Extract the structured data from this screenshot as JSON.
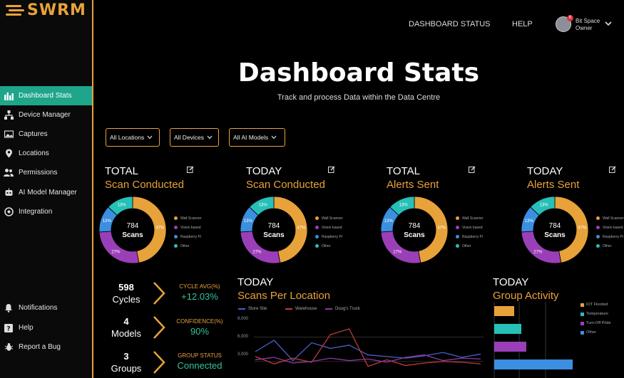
{
  "brand": {
    "logo": "SWRM"
  },
  "sidebar": {
    "items": [
      {
        "label": "Dashboard Stats"
      },
      {
        "label": "Device Manager"
      },
      {
        "label": "Captures"
      },
      {
        "label": "Locations"
      },
      {
        "label": "Permissions"
      },
      {
        "label": "AI Model Manager"
      },
      {
        "label": "Integration"
      }
    ],
    "bottom_items": [
      {
        "label": "Notifications"
      },
      {
        "label": "Help"
      },
      {
        "label": "Report a Bug"
      }
    ]
  },
  "topbar": {
    "dashboard_status": "DASHBOARD STATUS",
    "help": "HELP",
    "user_line1": "Bit Space",
    "user_line2": "Owner",
    "badge": "6"
  },
  "page": {
    "title": "Dashboard Stats",
    "subtitle": "Track and process Data within the Data Centre"
  },
  "filters": {
    "locations": "All Locations",
    "devices": "All Devices",
    "models": "All AI Models"
  },
  "cards": [
    {
      "line1": "TOTAL",
      "line2": "Scan Conducted",
      "center_value": "784",
      "center_label": "Scans"
    },
    {
      "line1": "TODAY",
      "line2": "Scan Conducted",
      "center_value": "784",
      "center_label": "Scans"
    },
    {
      "line1": "TOTAL",
      "line2": "Alerts Sent",
      "center_value": "784",
      "center_label": "Scans"
    },
    {
      "line1": "TODAY",
      "line2": "Alerts Sent",
      "center_value": "784",
      "center_label": "Scans"
    }
  ],
  "donut_segments": [
    {
      "name": "Wall Scanner",
      "pct": 47,
      "label": "47%",
      "color": "#e8a23a"
    },
    {
      "name": "Vision based",
      "pct": 27,
      "label": "27%",
      "color": "#9b3fb8"
    },
    {
      "name": "Raspberry Pi",
      "pct": 13,
      "label": "13%",
      "color": "#3b8fe0"
    },
    {
      "name": "Other",
      "pct": 13,
      "label": "13%",
      "color": "#27c0b8"
    }
  ],
  "metrics": [
    {
      "value": "598",
      "unit": "Cycles",
      "key": "CYCLE AVG(%)",
      "kvalue": "+12.03%"
    },
    {
      "value": "4",
      "unit": "Models",
      "key": "CONFIDENCE(%)",
      "kvalue": "90%"
    },
    {
      "value": "3",
      "unit": "Groups",
      "key": "GROUP STATUS",
      "kvalue": "Connected"
    }
  ],
  "scans_chart": {
    "line1": "TODAY",
    "line2": "Scans Per Location",
    "legend": [
      {
        "name": "Store Site",
        "color": "#4a5fc8"
      },
      {
        "name": "Warehouse",
        "color": "#c23a3a"
      },
      {
        "name": "Doug's Truck",
        "color": "#8a3aa0"
      }
    ],
    "yticks": [
      "9,000",
      "6,000",
      "3,000"
    ]
  },
  "group_chart": {
    "line1": "TODAY",
    "line2": "Group Activity",
    "legend": [
      {
        "name": "IOT Flooded",
        "color": "#e8a23a"
      },
      {
        "name": "Temperature",
        "color": "#27c0b8"
      },
      {
        "name": "Turn-Off Pride",
        "color": "#9b3fb8"
      },
      {
        "name": "Other",
        "color": "#3b8fe0"
      }
    ]
  },
  "chart_data": [
    {
      "type": "line",
      "title": "Scans Per Location",
      "x": [
        1,
        2,
        3,
        4,
        5,
        6,
        7,
        8,
        9,
        10,
        11,
        12,
        13
      ],
      "ylim": [
        0,
        10500
      ],
      "series": [
        {
          "name": "Store Site",
          "values": [
            4200,
            5600,
            3100,
            5300,
            4600,
            5000,
            3800,
            3600,
            3400,
            3700,
            4100,
            3500,
            3900
          ]
        },
        {
          "name": "Warehouse",
          "values": [
            3600,
            2700,
            3400,
            2900,
            6300,
            7000,
            2400,
            3200,
            2500,
            2800,
            3000,
            2900,
            2700
          ]
        },
        {
          "name": "Doug's Truck",
          "values": [
            3200,
            3500,
            2800,
            3000,
            3400,
            3100,
            3300,
            2900,
            3500,
            3800,
            3100,
            3400,
            3300
          ]
        }
      ]
    },
    {
      "type": "bar",
      "title": "Group Activity",
      "categories": [
        "IOT Flooded",
        "Temperature",
        "Turn-Off Pride",
        "Other"
      ],
      "values": [
        28,
        38,
        45,
        110
      ],
      "xlim": [
        0,
        120
      ]
    }
  ]
}
